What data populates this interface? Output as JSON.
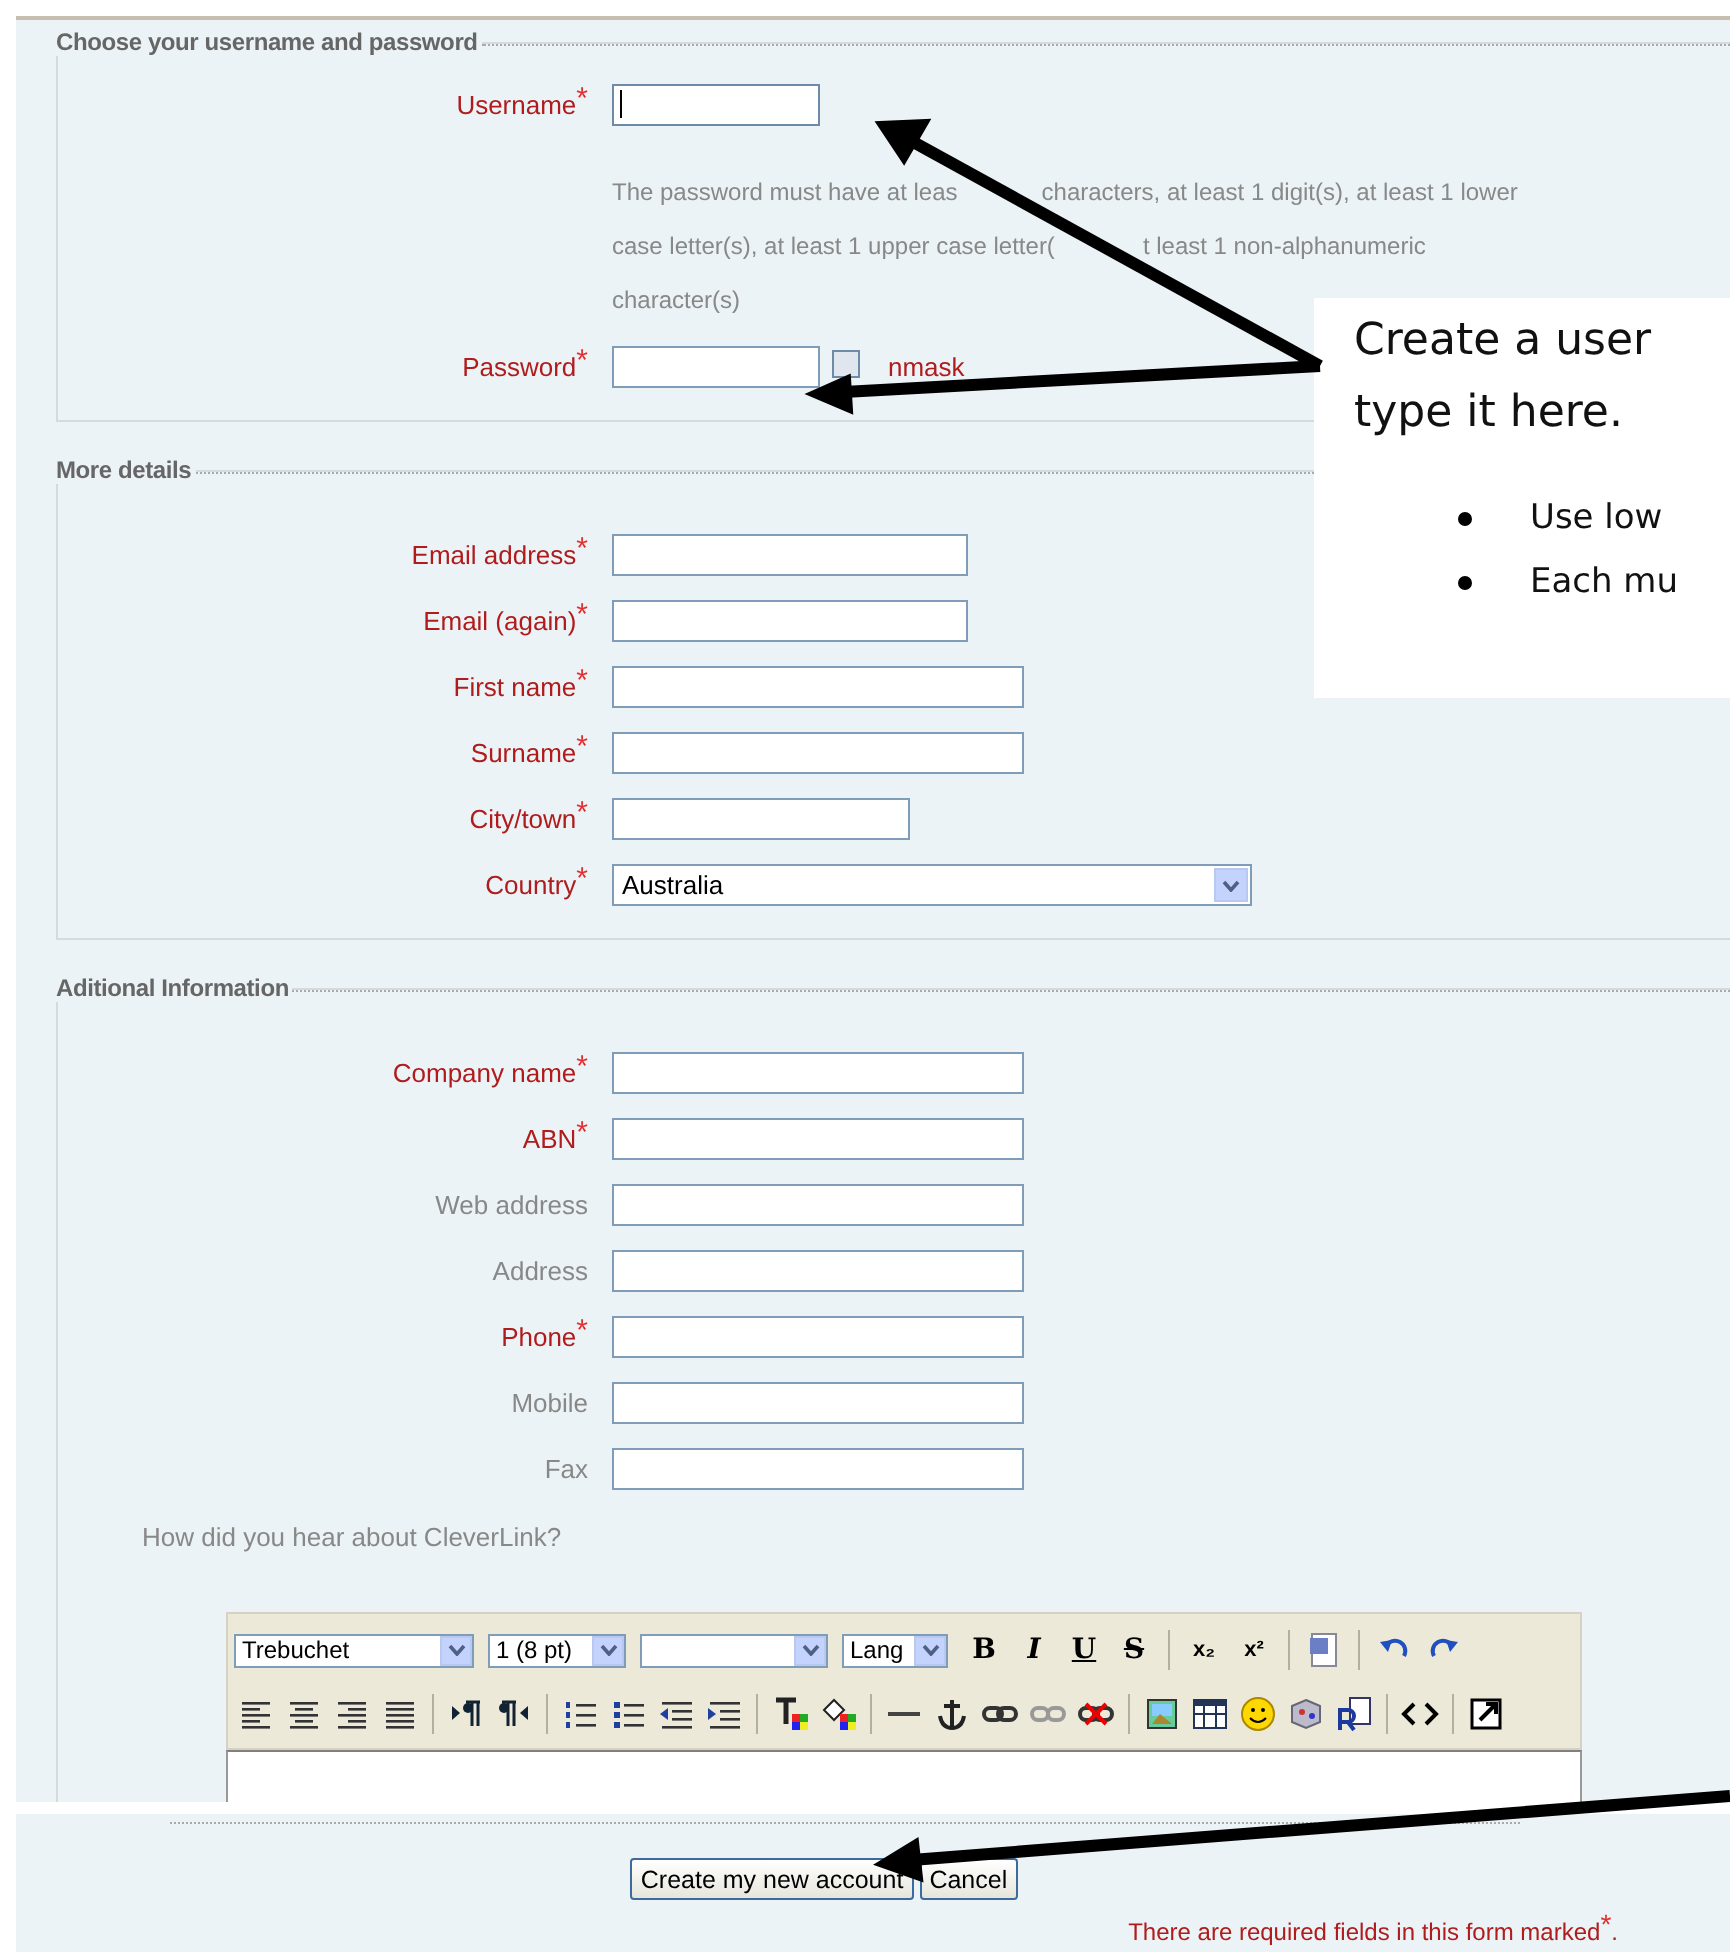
{
  "required_mark": "*",
  "sections": [
    {
      "legend": "Choose your username and password",
      "fields": [
        {
          "kind": "text",
          "label": "Username",
          "required": true,
          "focused": true
        },
        {
          "kind": "note",
          "lines": [
            [
              "The password must have at leas",
              "characters, at least 1 digit(s), at least 1 lower"
            ],
            [
              "case letter(s), at least 1 upper case letter(",
              "t least 1 non-alphanumeric"
            ],
            [
              "character(s)"
            ]
          ]
        },
        {
          "kind": "password",
          "label": "Password",
          "required": true,
          "unmask": {
            "label": "nmask",
            "checked": false
          }
        }
      ]
    },
    {
      "legend": "More details",
      "fields": [
        {
          "kind": "text",
          "label": "Email address",
          "required": true
        },
        {
          "kind": "text",
          "label": "Email (again)",
          "required": true
        },
        {
          "kind": "text",
          "label": "First name",
          "required": true
        },
        {
          "kind": "text",
          "label": "Surname",
          "required": true
        },
        {
          "kind": "text",
          "label": "City/town",
          "required": true
        },
        {
          "kind": "select",
          "label": "Country",
          "required": true,
          "value": "Australia"
        }
      ]
    },
    {
      "legend": "Aditional Information",
      "fields": [
        {
          "kind": "text",
          "label": "Company name",
          "required": true
        },
        {
          "kind": "text",
          "label": "ABN",
          "required": true
        },
        {
          "kind": "text",
          "label": "Web address",
          "required": false
        },
        {
          "kind": "text",
          "label": "Address",
          "required": false
        },
        {
          "kind": "text",
          "label": "Phone",
          "required": true
        },
        {
          "kind": "text",
          "label": "Mobile",
          "required": false
        },
        {
          "kind": "text",
          "label": "Fax",
          "required": false
        },
        {
          "kind": "editor",
          "label": "How did you hear about CleverLink?",
          "toolbar": {
            "selects": [
              {
                "kind": "value",
                "value": "Trebuchet"
              },
              {
                "kind": "value",
                "value": "1 (8 pt)"
              },
              {
                "kind": "empty"
              },
              {
                "kind": "value",
                "value": "Lang"
              }
            ],
            "format_buttons": [
              "B",
              "I",
              "U",
              "S"
            ],
            "script_buttons": [
              "x₂",
              "x²"
            ]
          }
        }
      ]
    }
  ],
  "buttons": [
    "Create my new account",
    "Cancel"
  ],
  "required_note": "There are required fields in this form marked$^{*}$.",
  "callout": {
    "lines": [
      "Create a user",
      "type it here."
    ],
    "bullets": [
      "Use low",
      "Each mu"
    ]
  }
}
